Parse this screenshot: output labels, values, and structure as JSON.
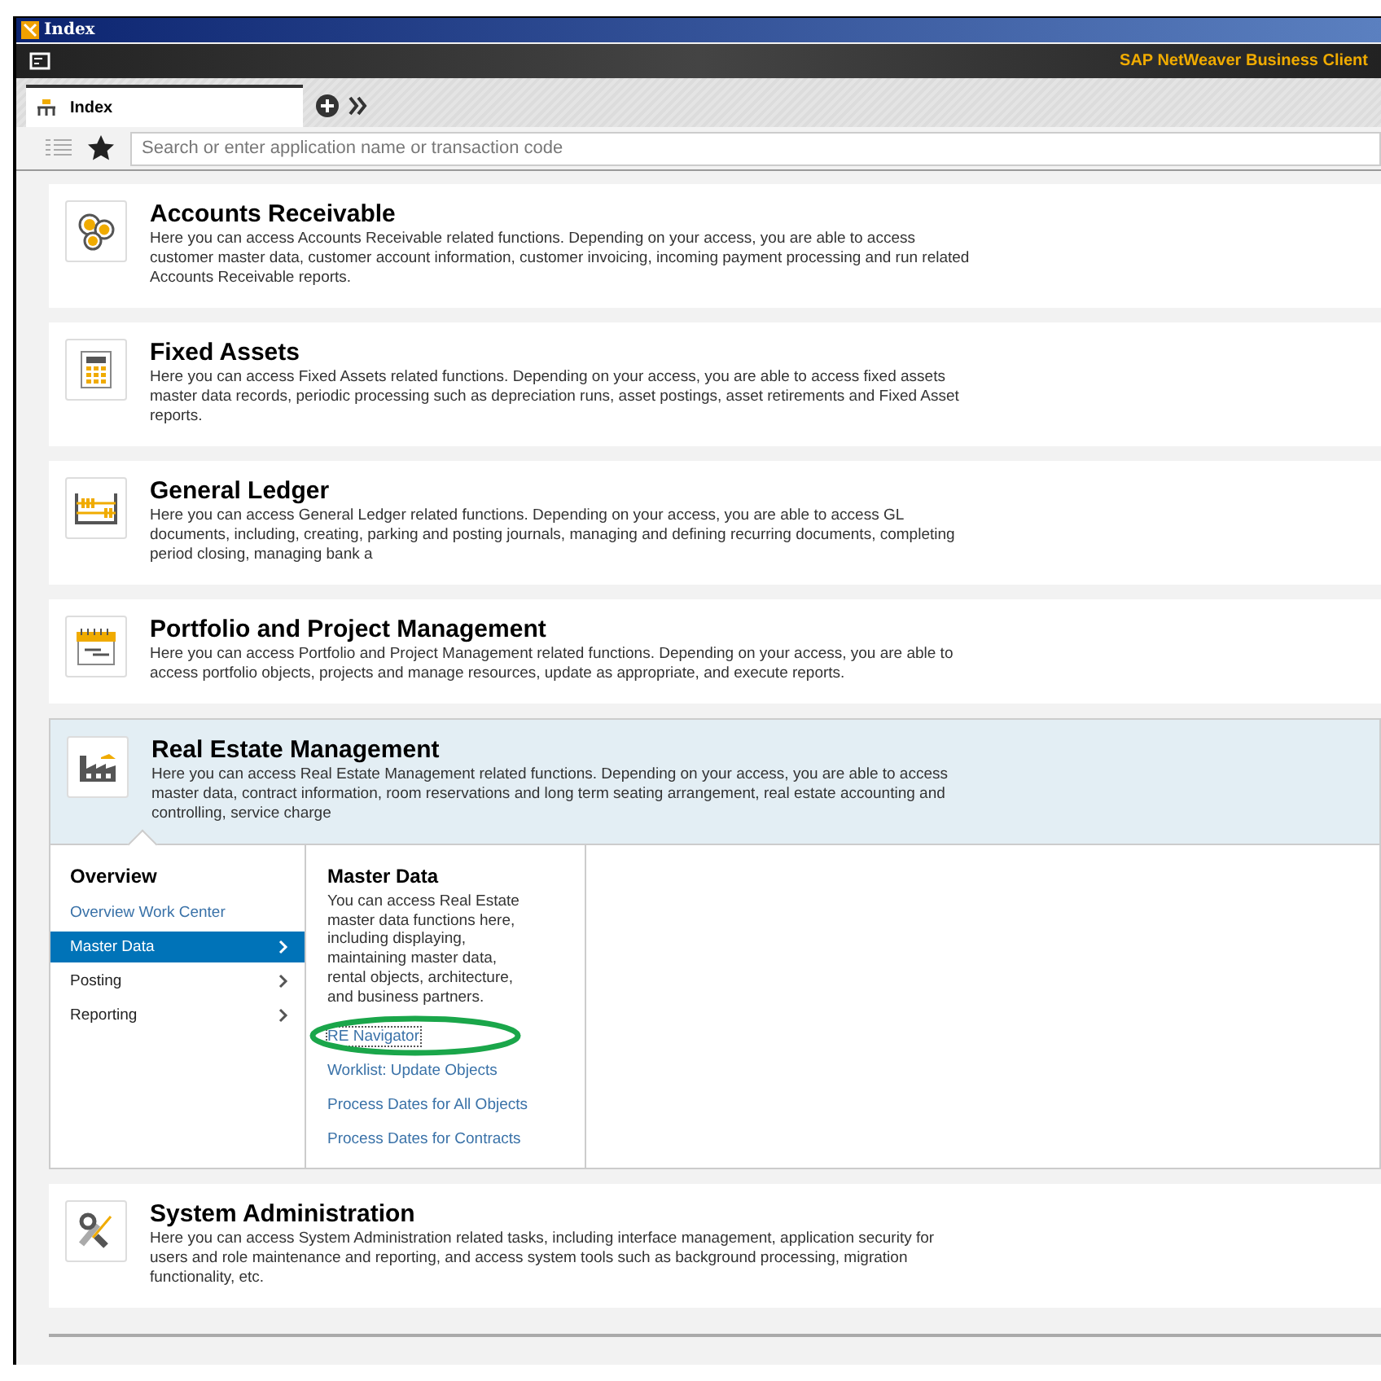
{
  "window": {
    "title": "Index"
  },
  "brand": "SAP NetWeaver Business Client",
  "tabs": [
    {
      "label": "Index",
      "selected": true
    }
  ],
  "search": {
    "placeholder": "Search or enter application name or transaction code"
  },
  "areas": [
    {
      "title": "Accounts Receivable",
      "description": "Here you can access Accounts Receivable related functions. Depending on your access, you are able to access customer master data, customer account information, customer invoicing, incoming payment processing and run related Accounts Receivable reports.",
      "expanded": false
    },
    {
      "title": "Fixed Assets",
      "description": "Here you can access Fixed Assets related functions. Depending on your access, you are able to access fixed assets master data records, periodic processing such as depreciation runs, asset postings, asset retirements and Fixed Asset reports.",
      "expanded": false
    },
    {
      "title": "General Ledger",
      "description": "Here you can access General Ledger related functions. Depending on your access, you are able to access GL documents, including, creating, parking and posting journals, managing and defining recurring documents, completing period closing, managing bank a",
      "expanded": false
    },
    {
      "title": "Portfolio and Project Management",
      "description": "Here you can access Portfolio and Project Management related functions. Depending on your access, you are able to access portfolio objects, projects and manage resources, update as appropriate, and execute reports.",
      "expanded": false
    },
    {
      "title": "Real Estate Management",
      "description": "Here you can access Real Estate Management related functions. Depending on your access, you are able to access master data, contract information, room reservations and long term seating arrangement, real estate accounting and controlling, service charge",
      "expanded": true,
      "menu": {
        "heading": "Overview",
        "items": [
          {
            "label": "Overview Work Center",
            "kind": "link",
            "selected": false
          },
          {
            "label": "Master Data",
            "kind": "category",
            "selected": true
          },
          {
            "label": "Posting",
            "kind": "category",
            "selected": false
          },
          {
            "label": "Reporting",
            "kind": "category",
            "selected": false
          }
        ]
      },
      "detail": {
        "title": "Master Data",
        "description": "You can access Real Estate master data functions here, including displaying, maintaining master data, rental objects, architecture, and business partners.",
        "links": [
          {
            "label": "RE Navigator",
            "focused": true,
            "highlighted": true
          },
          {
            "label": "Worklist: Update Objects",
            "focused": false,
            "highlighted": false
          },
          {
            "label": "Process Dates for All Objects",
            "focused": false,
            "highlighted": false
          },
          {
            "label": "Process Dates for Contracts",
            "focused": false,
            "highlighted": false
          }
        ]
      }
    },
    {
      "title": "System Administration",
      "description": "Here you can access System Administration related tasks, including interface management, application security for users and role maintenance and reporting, and access system tools such as background processing, migration functionality, etc.",
      "expanded": false
    }
  ]
}
